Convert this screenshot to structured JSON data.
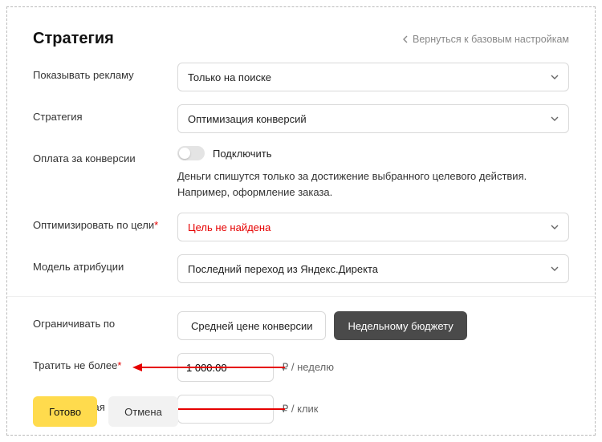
{
  "header": {
    "title": "Стратегия",
    "back_link": "Вернуться к базовым настройкам"
  },
  "labels": {
    "show_ads": "Показывать рекламу",
    "strategy": "Стратегия",
    "pay_per_conversion": "Оплата за конверсии",
    "optimize_goal": "Оптимизировать по цели",
    "optimize_goal_req": "*",
    "attribution": "Модель атрибуции",
    "limit_by": "Ограничивать по",
    "spend_max": "Тратить не более",
    "spend_max_req": "*",
    "max_price": "Максимальная цена"
  },
  "fields": {
    "show_ads": {
      "value": "Только на поиске"
    },
    "strategy": {
      "value": "Оптимизация конверсий"
    },
    "pay_per_conversion": {
      "enabled": false,
      "label": "Подключить",
      "description_line1": "Деньги спишутся только за достижение выбранного целевого действия.",
      "description_line2": "Например, оформление заказа."
    },
    "optimize_goal": {
      "value": "Цель не найдена",
      "error": true
    },
    "attribution": {
      "value": "Последний переход из Яндекс.Директа"
    },
    "limit_by": {
      "option_avg": "Средней цене конверсии",
      "option_budget": "Недельному бюджету",
      "active": "budget"
    },
    "spend_max": {
      "value": "1 000.00",
      "unit": "₽ / неделю"
    },
    "max_price": {
      "value": "",
      "unit": "₽ / клик"
    }
  },
  "footer": {
    "done": "Готово",
    "cancel": "Отмена"
  }
}
